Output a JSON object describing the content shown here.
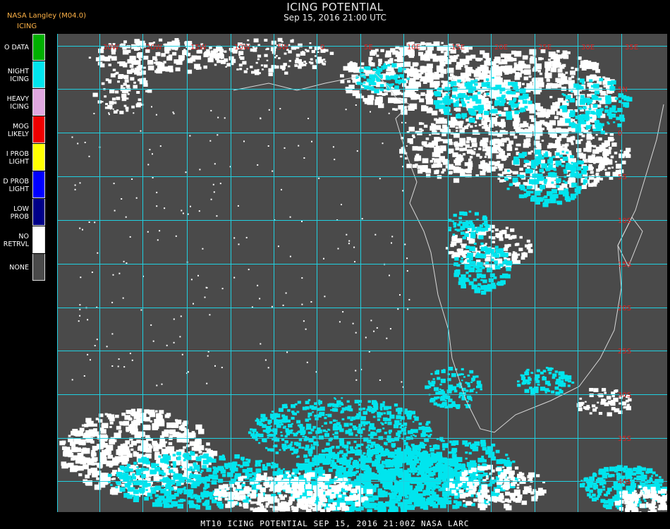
{
  "header": {
    "title": "ICING POTENTIAL",
    "subtitle": "Sep 15, 2016 21:00 UTC",
    "product": "NASA Langley (M04.0)",
    "legend_title": "ICING"
  },
  "legend": [
    {
      "label": "O DATA",
      "color": "#00b000"
    },
    {
      "label": "NIGHT\nICING",
      "color": "#00e5ee"
    },
    {
      "label": "HEAVY\nICING",
      "color": "#e0a8e0"
    },
    {
      "label": "MOG\nLIKELY",
      "color": "#ee0000"
    },
    {
      "label": "I PROB\nLIGHT",
      "color": "#ffff00"
    },
    {
      "label": "D PROB\nLIGHT",
      "color": "#0000ff"
    },
    {
      "label": "LOW\nPROB",
      "color": "#000088"
    },
    {
      "label": "NO\nRETRVL",
      "color": "#ffffff"
    },
    {
      "label": "NONE",
      "color": "#4a4a4a"
    }
  ],
  "map": {
    "background_color": "#4a4a4a",
    "grid_color": "#20d0e0",
    "coast_color": "#d8d8d8",
    "lon_labels": [
      "30W",
      "20W",
      "15W",
      "10W",
      "5W",
      "0",
      "5E",
      "10E",
      "15E",
      "20E",
      "25E",
      "30E",
      "35E"
    ],
    "lat_labels": [
      "5N",
      "0",
      "5S",
      "10S",
      "15S",
      "20S",
      "25S",
      "30S",
      "35S",
      "40S"
    ]
  },
  "footer": "MT10   ICING POTENTIAL    SEP 15, 2016 21:00Z    NASA LARC"
}
